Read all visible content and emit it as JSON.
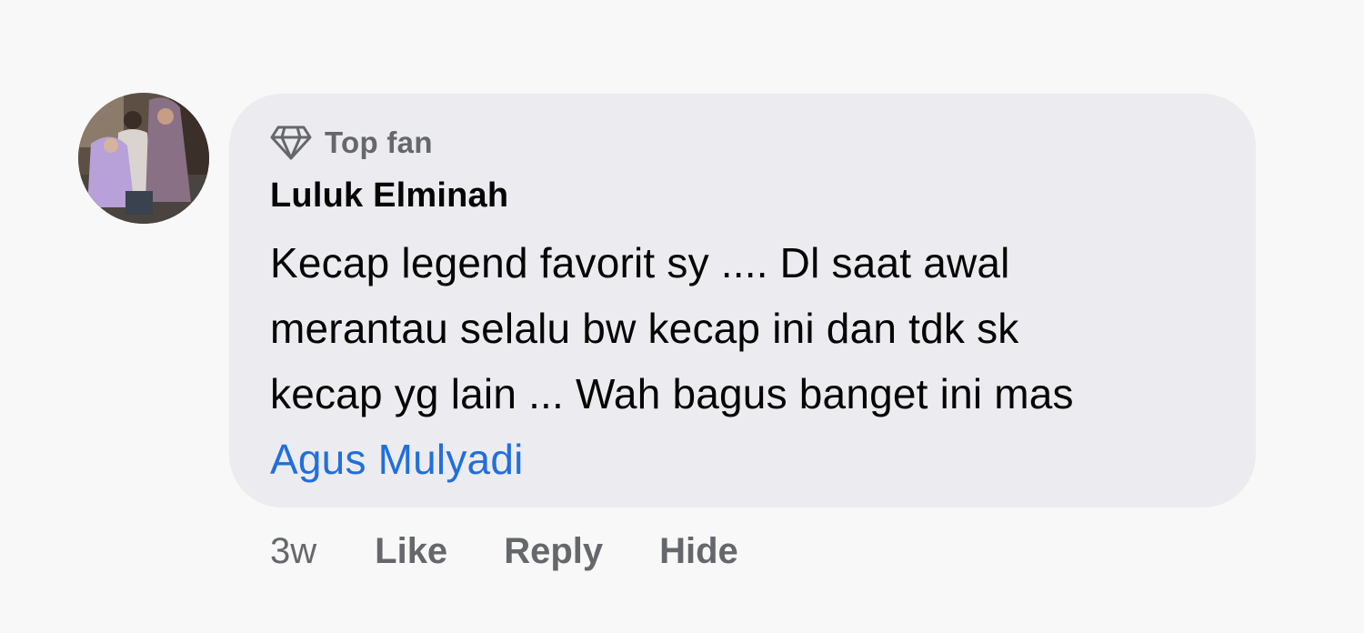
{
  "comment": {
    "badge": {
      "icon": "diamond-icon",
      "label": "Top fan"
    },
    "author": "Luluk Elminah",
    "text_lines": [
      "Kecap legend favorit sy .... Dl saat awal",
      "merantau selalu bw kecap ini dan tdk sk",
      "kecap yg lain ... Wah bagus banget ini mas"
    ],
    "mention": "Agus Mulyadi",
    "timestamp": "3w",
    "actions": {
      "like": "Like",
      "reply": "Reply",
      "hide": "Hide"
    }
  },
  "colors": {
    "background": "#f8f8f9",
    "bubble": "#ececf0",
    "text": "#050505",
    "secondary_text": "#65676b",
    "mention": "#216fdb"
  }
}
